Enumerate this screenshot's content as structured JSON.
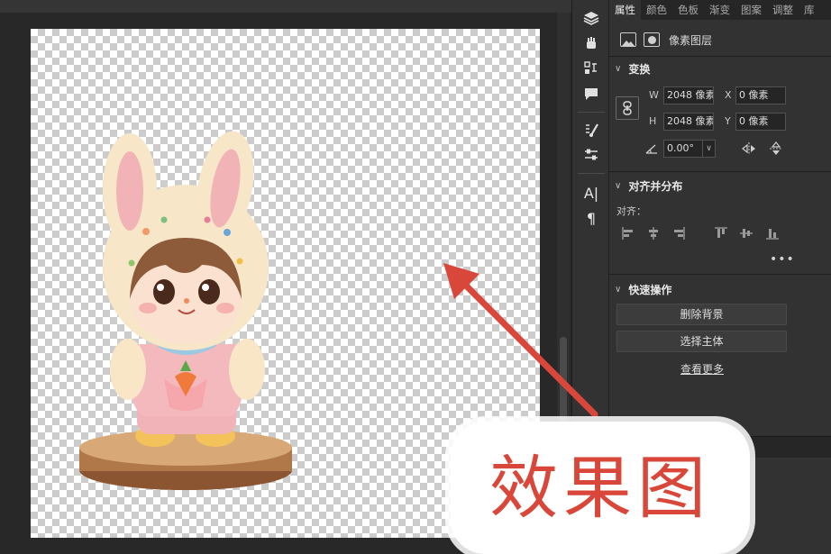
{
  "tabs": [
    "属性",
    "颜色",
    "色板",
    "渐变",
    "图案",
    "调整",
    "库"
  ],
  "layer_type": "像素图层",
  "transform": {
    "title": "变换",
    "w_label": "W",
    "w_value": "2048 像素",
    "h_label": "H",
    "h_value": "2048 像素",
    "x_label": "X",
    "x_value": "0 像素",
    "y_label": "Y",
    "y_value": "0 像素",
    "angle_value": "0.00°"
  },
  "align": {
    "title": "对齐并分布",
    "label": "对齐：",
    "more": "•••"
  },
  "quick_actions": {
    "title": "快速操作",
    "remove_bg": "删除背景",
    "select_subject": "选择主体",
    "see_more": "查看更多"
  },
  "toolstrip": {
    "type_tool": "A|",
    "paragraph_tool": "¶"
  },
  "annotation": {
    "callout_text": "效果图",
    "color": "#d9473a"
  },
  "icons": [
    "layers-icon",
    "hand-icon",
    "history-icon",
    "comment-icon",
    "brush-settings-icon",
    "adjustments-icon",
    "character-icon",
    "paragraph-icon",
    "image-icon",
    "mask-icon",
    "link-icon",
    "angle-icon",
    "flip-horizontal-icon",
    "flip-vertical-icon"
  ],
  "colors": {
    "panel_bg": "#323232",
    "canvas_bg": "#282828",
    "accent_red": "#d9473a"
  }
}
